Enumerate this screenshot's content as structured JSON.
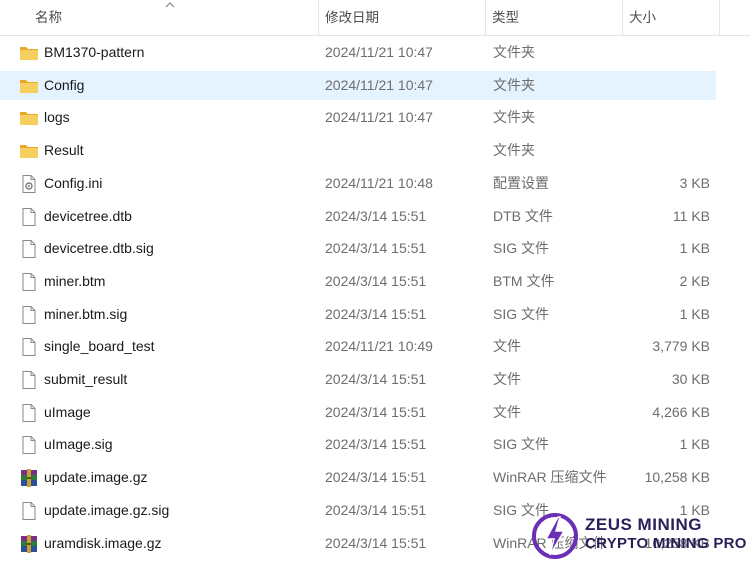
{
  "columns": {
    "name": "名称",
    "modified": "修改日期",
    "type": "类型",
    "size": "大小"
  },
  "colors": {
    "selected_row": "#e5f3ff",
    "folder": "#f4c24d",
    "watermark_purple": "#6a2fb3"
  },
  "files": [
    {
      "name": "BM1370-pattern",
      "date": "2024/11/21 10:47",
      "type": "文件夹",
      "size": "",
      "icon": "folder-icon"
    },
    {
      "name": "Config",
      "date": "2024/11/21 10:47",
      "type": "文件夹",
      "size": "",
      "icon": "folder-icon",
      "selected": true
    },
    {
      "name": "logs",
      "date": "2024/11/21 10:47",
      "type": "文件夹",
      "size": "",
      "icon": "folder-icon"
    },
    {
      "name": "Result",
      "date": "",
      "type": "文件夹",
      "size": "",
      "icon": "folder-icon"
    },
    {
      "name": "Config.ini",
      "date": "2024/11/21 10:48",
      "type": "配置设置",
      "size": "3 KB",
      "icon": "settings-file-icon"
    },
    {
      "name": "devicetree.dtb",
      "date": "2024/3/14 15:51",
      "type": "DTB 文件",
      "size": "11 KB",
      "icon": "file-icon"
    },
    {
      "name": "devicetree.dtb.sig",
      "date": "2024/3/14 15:51",
      "type": "SIG 文件",
      "size": "1 KB",
      "icon": "file-icon"
    },
    {
      "name": "miner.btm",
      "date": "2024/3/14 15:51",
      "type": "BTM 文件",
      "size": "2 KB",
      "icon": "file-icon"
    },
    {
      "name": "miner.btm.sig",
      "date": "2024/3/14 15:51",
      "type": "SIG 文件",
      "size": "1 KB",
      "icon": "file-icon"
    },
    {
      "name": "single_board_test",
      "date": "2024/11/21 10:49",
      "type": "文件",
      "size": "3,779 KB",
      "icon": "file-icon"
    },
    {
      "name": "submit_result",
      "date": "2024/3/14 15:51",
      "type": "文件",
      "size": "30 KB",
      "icon": "file-icon"
    },
    {
      "name": "uImage",
      "date": "2024/3/14 15:51",
      "type": "文件",
      "size": "4,266 KB",
      "icon": "file-icon"
    },
    {
      "name": "uImage.sig",
      "date": "2024/3/14 15:51",
      "type": "SIG 文件",
      "size": "1 KB",
      "icon": "file-icon"
    },
    {
      "name": "update.image.gz",
      "date": "2024/3/14 15:51",
      "type": "WinRAR 压缩文件",
      "size": "10,258 KB",
      "icon": "winrar-archive-icon"
    },
    {
      "name": "update.image.gz.sig",
      "date": "2024/3/14 15:51",
      "type": "SIG 文件",
      "size": "1 KB",
      "icon": "file-icon"
    },
    {
      "name": "uramdisk.image.gz",
      "date": "2024/3/14 15:51",
      "type": "WinRAR 压缩文件",
      "size": "10,258 KB",
      "icon": "winrar-archive-icon"
    }
  ],
  "watermark": {
    "line1": "ZEUS MINING",
    "line2": "CRYPTO MINING PRO"
  }
}
